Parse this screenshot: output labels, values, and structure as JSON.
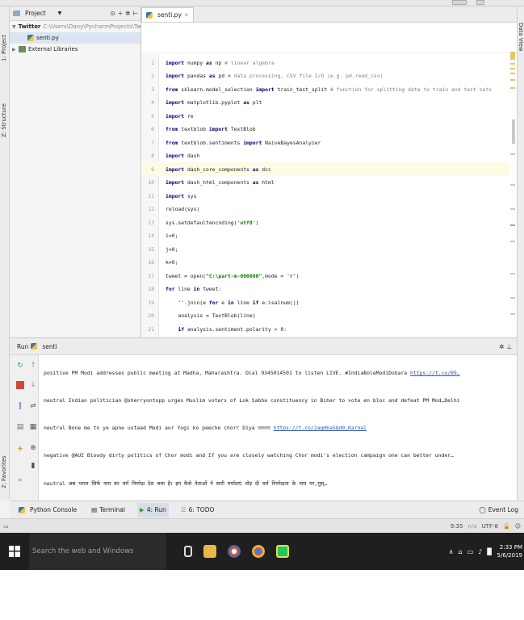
{
  "project_pane": {
    "title": "Project",
    "root_name": "Twitter",
    "root_path": "C:\\Users\\Dany\\PycharmProjects\\Twitter",
    "file": "senti.py",
    "external": "External Libraries"
  },
  "side_labels": {
    "project": "1: Project",
    "structure": "Z: Structure",
    "favorites": "2: Favorites",
    "database": "Data View"
  },
  "editor": {
    "tab_label": "senti.py",
    "lines": [
      {
        "n": "1",
        "text": "import numpy as np # linear algebra"
      },
      {
        "n": "2",
        "text": "import pandas as pd # data processing, CSV file I/O (e.g. pd.read_csv)"
      },
      {
        "n": "3",
        "text": "from sklearn.model_selection import train_test_split # function for splitting data to train and test sets"
      },
      {
        "n": "4",
        "text": "import matplotlib.pyplot as plt"
      },
      {
        "n": "5",
        "text": "import re"
      },
      {
        "n": "6",
        "text": "from textblob import TextBlob"
      },
      {
        "n": "7",
        "text": "from textblob.sentiments import NaiveBayesAnalyzer"
      },
      {
        "n": "8",
        "text": "import dash"
      },
      {
        "n": "9",
        "text": "import dash_core_components as dcc"
      },
      {
        "n": "10",
        "text": "import dash_html_components as html"
      },
      {
        "n": "11",
        "text": "import sys"
      },
      {
        "n": "12",
        "text": "reload(sys)"
      },
      {
        "n": "13",
        "text": "sys.setdefaultencoding('utf8')"
      },
      {
        "n": "14",
        "text": "i=0;"
      },
      {
        "n": "15",
        "text": "j=0;"
      },
      {
        "n": "16",
        "text": "k=0;"
      },
      {
        "n": "17",
        "text": "tweet = open(\"C:\\part-m-000000\",mode = 'r')"
      },
      {
        "n": "18",
        "text": "for line in tweet:"
      },
      {
        "n": "19",
        "text": "    ''.join(e for e in line if e.isalnum())"
      },
      {
        "n": "20",
        "text": "    analysis = TextBlob(line)"
      },
      {
        "n": "21",
        "text": "    if analysis.sentiment.polarity > 0:"
      }
    ]
  },
  "run_panel": {
    "label": "Run",
    "config": "senti",
    "output": [
      {
        "text": "positive  PM Modi addresses public meeting at Madha, Maharashtra. Dial 9345014501 to listen LIVE. #IndiaBoleModiDobara ",
        "link": "https://t.co/B9…"
      },
      {
        "text": "neutral  Indian politician @sherryontopp urges Muslim voters of Lok Sabha constituency in Bihar to vote en bloc and defeat PM Mod…Delhi",
        "link": ""
      },
      {
        "text": "neutral  Bone me to ye apne ustaad Modi aur Yogi ko peeche chorr Diya ☺☺☺☺ ",
        "link": "https://t.co/2agHba5Qd0,Karnal"
      },
      {
        "text": "negative  @AUI Bloody dirty politics of Chor modi and If you are closely watching Chor modi's election campaign one can better under…",
        "link": ""
      },
      {
        "text": "neutral  अब भारत सिर्फ नाम का धर्म निरपेक्ष देश बचा है। इन कैसे नेताओं ने सारी मर्यादाएं तोड़ दी धर्म निरपेक्षता के नाम पर,मुस्…",
        "link": ""
      }
    ]
  },
  "tool_tabs": {
    "python_console": "Python Console",
    "terminal": "Terminal",
    "run": "4: Run",
    "todo": "6: TODO",
    "event_log": "Event Log"
  },
  "status": {
    "position": "9:35",
    "separator": "n/a",
    "encoding": "UTF-8"
  },
  "taskbar": {
    "search_placeholder": "Search the web and Windows",
    "time": "2:33 PM",
    "date": "5/6/2019"
  },
  "colors": {
    "keyword": "#000080",
    "string": "#008000",
    "comment": "#808080",
    "taskbar": "#1f1f1f",
    "link": "#2a55b8"
  }
}
